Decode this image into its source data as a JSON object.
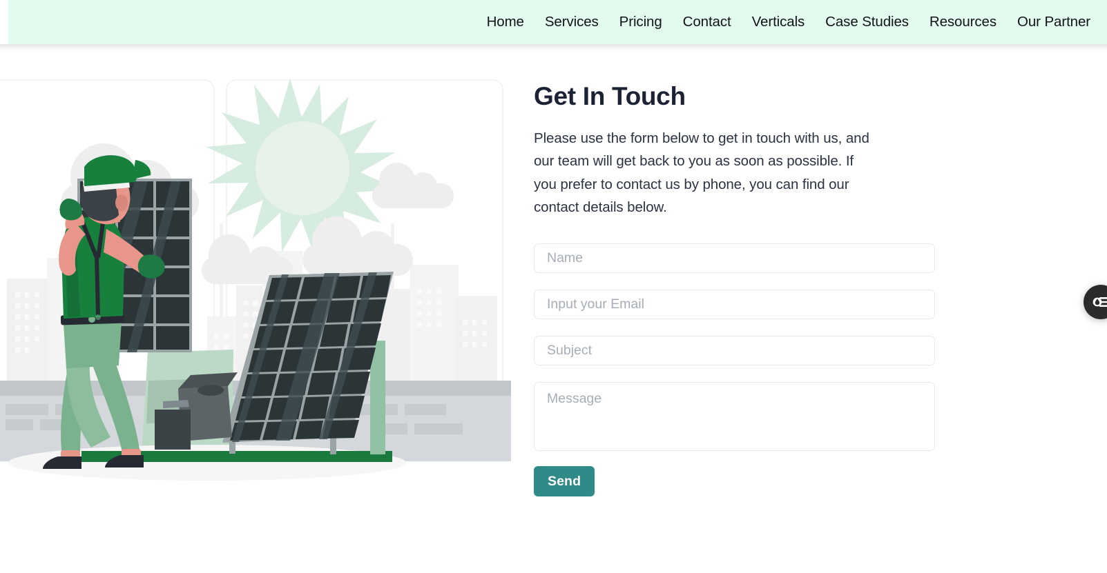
{
  "nav": {
    "items": [
      {
        "label": "Home"
      },
      {
        "label": "Services"
      },
      {
        "label": "Pricing"
      },
      {
        "label": "Contact"
      },
      {
        "label": "Verticals"
      },
      {
        "label": "Case Studies"
      },
      {
        "label": "Resources"
      },
      {
        "label": "Our Partner"
      }
    ],
    "background_color": "#e2fbee",
    "text_color": "#111318"
  },
  "main": {
    "title": "Get In Touch",
    "description": "Please use the form below to get in touch with us, and our team will get back to you as soon as possible. If you prefer to contact us by phone, you can find our contact details below.",
    "title_color": "#1b2234"
  },
  "form": {
    "name": {
      "placeholder": "Name",
      "value": ""
    },
    "email": {
      "placeholder": "Input your Email",
      "value": ""
    },
    "subject": {
      "placeholder": "Subject",
      "value": ""
    },
    "message": {
      "placeholder": "Message",
      "value": ""
    },
    "submit_label": "Send",
    "submit_color": "#2f8a88",
    "placeholder_color": "#a7adb6",
    "border_color": "#e6e9ec"
  },
  "illustration": {
    "name": "solar-panel-installer-illustration",
    "alt": "Worker installing solar panels on a rooftop with sun, clouds and city skyline",
    "colors": {
      "sun": "#d7ece0",
      "sun_core": "#e6f2ea",
      "cloud": "#eeeeee",
      "skyline": "#f2f2f2",
      "panel_dark": "#2b3538",
      "panel_frame": "#9aa3a6",
      "shirt_green": "#16803c",
      "pants_green": "#79b28d",
      "skin": "#e8968a",
      "wall_gray": "#c2c7cb",
      "ground_green": "#1a7a3e",
      "toolbox_gray": "#5c6468"
    }
  },
  "floating_widget": {
    "name": "accessibility-settings-widget",
    "icon": "settings-sliders-icon",
    "background_color": "#2b2b2b"
  }
}
